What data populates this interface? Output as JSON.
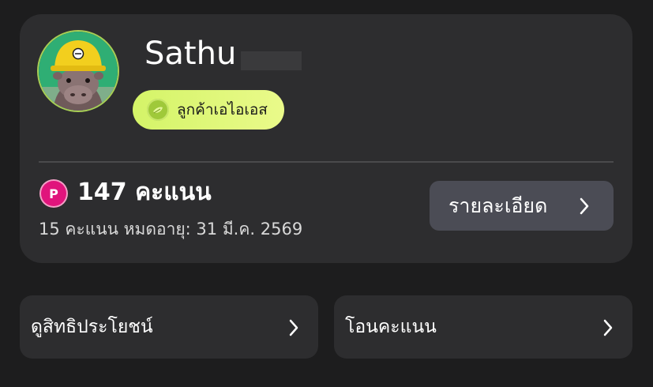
{
  "profile": {
    "username": "Sathu",
    "tier_label": "ลูกค้าเอไอเอส",
    "avatar_icon": "avatar-hippo-image",
    "tier_icon": "leaf-coin-icon"
  },
  "points": {
    "badge_letter": "P",
    "total": "147 คะแนน",
    "expiry_text": "15 คะแนน  หมดอายุ: 31 มี.ค. 2569",
    "details_label": "รายละเอียด"
  },
  "actions": {
    "benefits_label": "ดูสิทธิประโยชน์",
    "transfer_label": "โอนคะแนน"
  },
  "colors": {
    "background": "#1d1d1e",
    "card": "#2d2d2f",
    "tier_badge": "#d4f468",
    "points_icon": "#e0147c",
    "details_button": "#4b4c55"
  }
}
